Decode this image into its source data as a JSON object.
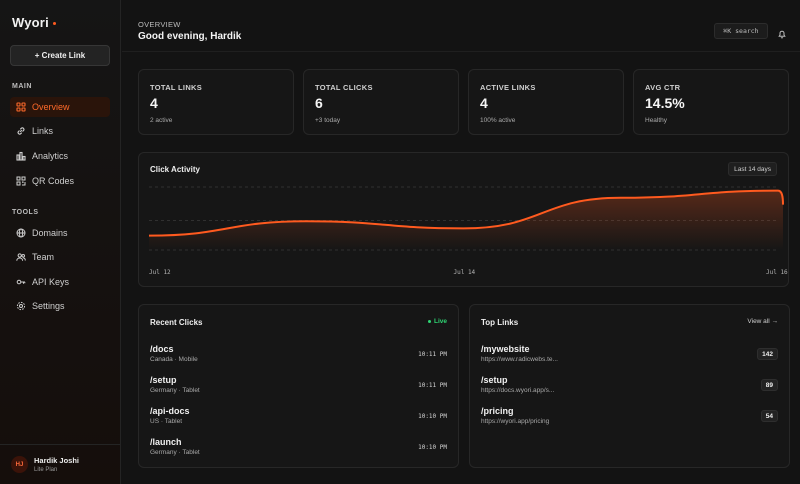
{
  "sidebar": {
    "brand": "Wyori",
    "create_label": "+ Create Link",
    "main_label": "MAIN",
    "tools_label": "TOOLS",
    "main_items": [
      {
        "label": "Overview",
        "icon": "grid-icon",
        "active": true
      },
      {
        "label": "Links",
        "icon": "link-icon"
      },
      {
        "label": "Analytics",
        "icon": "bar-chart-icon"
      },
      {
        "label": "QR Codes",
        "icon": "qr-code-icon"
      }
    ],
    "tool_items": [
      {
        "label": "Domains",
        "icon": "globe-icon"
      },
      {
        "label": "Team",
        "icon": "users-icon"
      },
      {
        "label": "API Keys",
        "icon": "key-icon"
      },
      {
        "label": "Settings",
        "icon": "gear-icon"
      }
    ],
    "user": {
      "initials": "HJ",
      "name": "Hardik Joshi",
      "plan": "Lite Plan"
    }
  },
  "header": {
    "kicker": "OVERVIEW",
    "title": "Good evening, Hardik",
    "search_label": "⌘K search"
  },
  "stats": [
    {
      "label": "TOTAL LINKS",
      "value": "4",
      "sub": "2 active"
    },
    {
      "label": "TOTAL CLICKS",
      "value": "6",
      "sub": "+3 today"
    },
    {
      "label": "ACTIVE LINKS",
      "value": "4",
      "sub": "100% active"
    },
    {
      "label": "AVG CTR",
      "value": "14.5%",
      "sub": "Healthy"
    }
  ],
  "activity": {
    "title": "Click Activity",
    "range": "Last 14 days"
  },
  "chart_data": {
    "type": "area",
    "x_ticks": [
      "Jul 12",
      "Jul 14",
      "Jul 16"
    ],
    "x": [
      "Jul 12",
      "Jul 13",
      "Jul 14",
      "Jul 15",
      "Jul 16"
    ],
    "values": [
      0.8,
      1.6,
      1.2,
      2.9,
      3.3
    ],
    "ylim": [
      0,
      3.5
    ],
    "grid": true,
    "color": "#ff5a1f"
  },
  "recent": {
    "title": "Recent Clicks",
    "live_label": "Live",
    "items": [
      {
        "path": "/docs",
        "meta": "Canada · Mobile",
        "time": "10:11 PM"
      },
      {
        "path": "/setup",
        "meta": "Germany · Tablet",
        "time": "10:11 PM"
      },
      {
        "path": "/api-docs",
        "meta": "US · Tablet",
        "time": "10:10 PM"
      },
      {
        "path": "/launch",
        "meta": "Germany · Tablet",
        "time": "10:10 PM"
      }
    ]
  },
  "top": {
    "title": "Top Links",
    "view_all": "View all →",
    "items": [
      {
        "path": "/mywebsite",
        "url": "https://www.radicwebs.te...",
        "count": "142"
      },
      {
        "path": "/setup",
        "url": "https://docs.wyori.app/s...",
        "count": "89"
      },
      {
        "path": "/pricing",
        "url": "https://wyori.app/pricing",
        "count": "54"
      }
    ]
  },
  "colors": {
    "accent": "#ff5a1f",
    "live": "#2ed573"
  }
}
